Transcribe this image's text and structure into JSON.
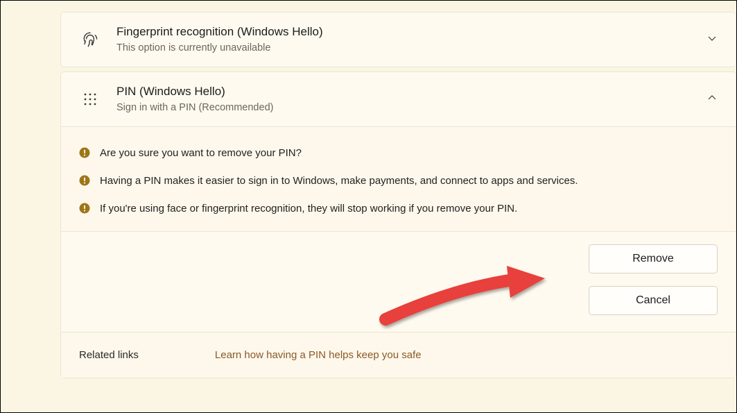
{
  "fingerprint": {
    "title": "Fingerprint recognition (Windows Hello)",
    "subtitle": "This option is currently unavailable"
  },
  "pin": {
    "title": "PIN (Windows Hello)",
    "subtitle": "Sign in with a PIN (Recommended)"
  },
  "warnings": {
    "w1": "Are you sure you want to remove your PIN?",
    "w2": "Having a PIN makes it easier to sign in to Windows, make payments, and connect to apps and services.",
    "w3": "If you're using face or fingerprint recognition, they will stop working if you remove your PIN."
  },
  "buttons": {
    "remove": "Remove",
    "cancel": "Cancel"
  },
  "related": {
    "label": "Related links",
    "link": "Learn how having a PIN helps keep you safe"
  }
}
